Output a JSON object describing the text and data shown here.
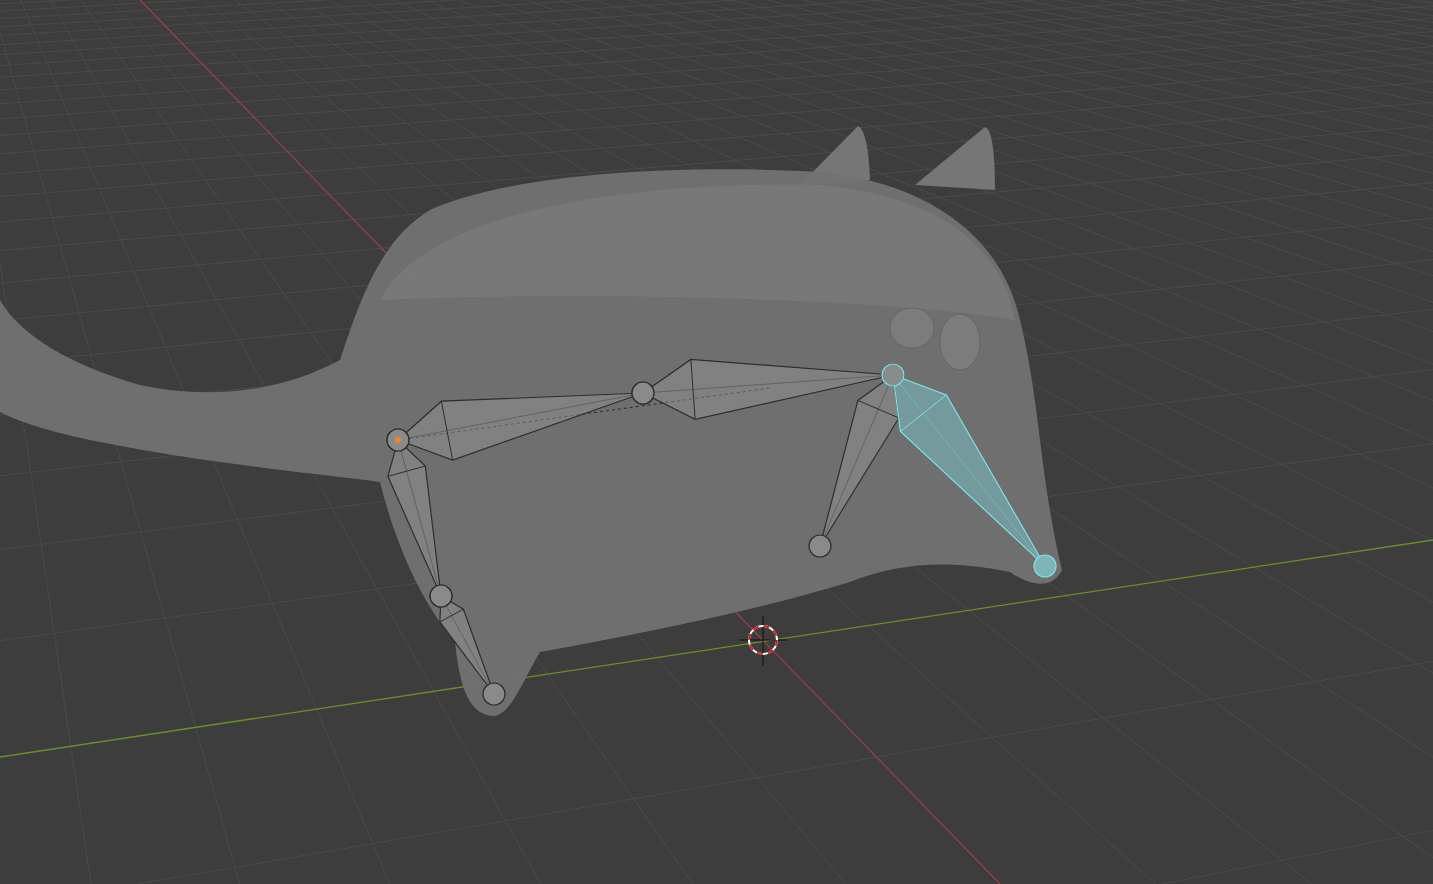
{
  "bones": [
    {
      "selected": false
    },
    {
      "selected": false
    },
    {
      "selected": false
    },
    {
      "selected": false
    },
    {
      "selected": false
    },
    {
      "selected": true
    }
  ]
}
